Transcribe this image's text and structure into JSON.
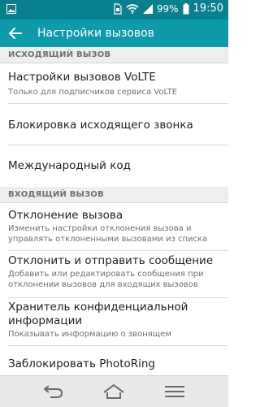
{
  "status_bar": {
    "battery": "99%",
    "time": "19:50",
    "icons": [
      "image-notification-icon",
      "sim-icon",
      "wifi-icon",
      "signal-icon",
      "battery-icon"
    ]
  },
  "app_bar": {
    "title": "Настройки вызовов",
    "back_icon": "back-arrow-icon"
  },
  "sections": [
    {
      "header": "ИСХОДЯЩИЙ ВЫЗОВ",
      "items": [
        {
          "title": "Настройки вызовов VoLTE",
          "subtitle": "Только для подписчиков сервиса VoLTE"
        },
        {
          "title": "Блокировка исходящего звонка"
        },
        {
          "title": "Международный код"
        }
      ]
    },
    {
      "header": "ВХОДЯЩИЙ ВЫЗОВ",
      "items": [
        {
          "title": "Отклонение вызова",
          "subtitle": "Изменить настройки отклонения вызова и управлять отклоненными вызовами из списка"
        },
        {
          "title": "Отклонить и отправить сообщение",
          "subtitle": "Добавить или редактировать сообщения при отклонении вызовов для входящих вызовов"
        },
        {
          "title": "Хранитель конфиденциальной информации",
          "subtitle": "Показывать информацию о звонящем"
        },
        {
          "title": "Заблокировать PhotoRing"
        }
      ]
    }
  ],
  "nav_bar": {
    "icons": [
      "back-icon",
      "home-icon",
      "menu-icon"
    ]
  },
  "colors": {
    "status_bar": "#0a7f8e",
    "app_bar": "#0e9aa8",
    "section_bg": "#eeeeee"
  }
}
